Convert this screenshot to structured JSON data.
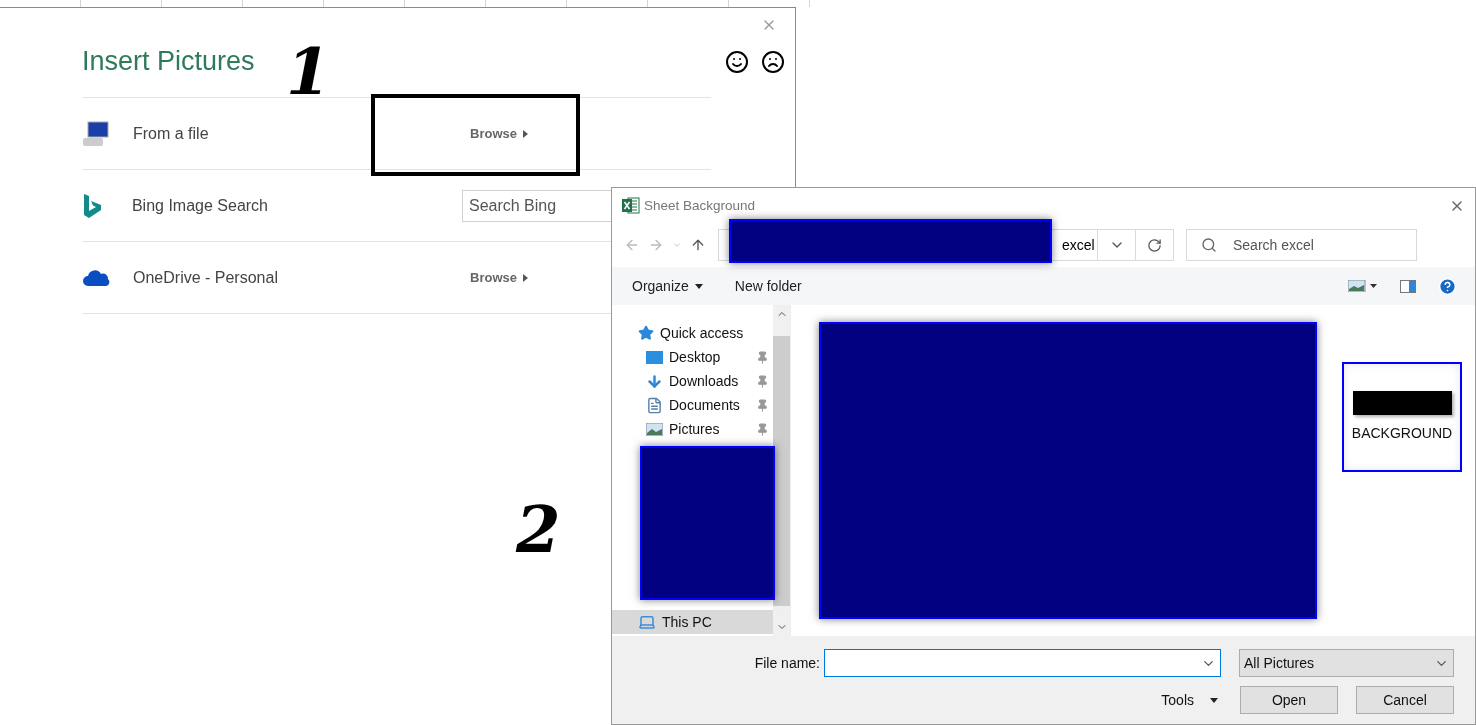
{
  "insert_pictures": {
    "title": "Insert Pictures",
    "sources": [
      {
        "kind": "file",
        "label": "From a file",
        "action": "Browse"
      },
      {
        "kind": "bing",
        "label": "Bing Image Search",
        "placeholder": "Search Bing"
      },
      {
        "kind": "onedrive",
        "label": "OneDrive - Personal",
        "action": "Browse"
      }
    ]
  },
  "annotations": [
    "1",
    "2"
  ],
  "file_dialog": {
    "title": "Sheet Background",
    "address": "excel",
    "search_placeholder": "Search excel",
    "toolbar": [
      {
        "label": "Organize",
        "menu": true
      },
      {
        "label": "New folder",
        "menu": false
      }
    ],
    "nav": [
      {
        "kind": "star",
        "label": "Quick access",
        "pinned": false,
        "selected": false
      },
      {
        "kind": "desktop",
        "label": "Desktop",
        "pinned": true,
        "selected": false
      },
      {
        "kind": "downloads",
        "label": "Downloads",
        "pinned": true,
        "selected": false
      },
      {
        "kind": "documents",
        "label": "Documents",
        "pinned": true,
        "selected": false
      },
      {
        "kind": "pictures",
        "label": "Pictures",
        "pinned": true,
        "selected": false
      },
      {
        "kind": "pc",
        "label": "This PC",
        "pinned": false,
        "selected": true
      }
    ],
    "files": [
      {
        "name": "BACKGROUND",
        "selected": true
      }
    ],
    "file_name_label": "File name:",
    "file_type": "All Pictures",
    "tools": "Tools",
    "buttons": [
      "Open",
      "Cancel"
    ]
  }
}
